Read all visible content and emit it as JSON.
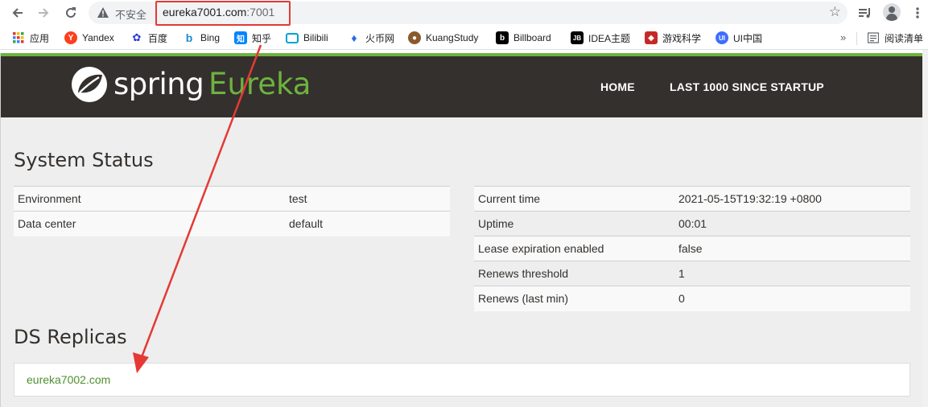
{
  "browser": {
    "insecure_label": "不安全",
    "url_host": "eureka7001.com",
    "url_port": ":7001",
    "bookmarks": [
      {
        "label": "应用",
        "icon": "apps-grid-icon",
        "color": "#e53935"
      },
      {
        "label": "Yandex",
        "icon": "yandex-icon",
        "color": "#fc3f1d"
      },
      {
        "label": "百度",
        "icon": "baidu-icon",
        "color": "#2932e1"
      },
      {
        "label": "Bing",
        "icon": "bing-icon",
        "color": "#008373"
      },
      {
        "label": "知乎",
        "icon": "zhihu-icon",
        "color": "#0084ff"
      },
      {
        "label": "Bilibili",
        "icon": "bilibili-icon",
        "color": "#00a1d6"
      },
      {
        "label": "火币网",
        "icon": "huobi-icon",
        "color": "#2a6ae8"
      },
      {
        "label": "KuangStudy",
        "icon": "kuangstudy-icon",
        "color": "#8a5a2b"
      },
      {
        "label": "Billboard",
        "icon": "billboard-icon",
        "color": "#000000"
      },
      {
        "label": "IDEA主题",
        "icon": "jetbrains-icon",
        "color": "#000000"
      },
      {
        "label": "游戏科学",
        "icon": "game-science-icon",
        "color": "#c62828"
      },
      {
        "label": "UI中国",
        "icon": "ui-china-icon",
        "color": "#3d6dff"
      }
    ],
    "bookmarks_more": "»",
    "reading_list": "阅读清单"
  },
  "header": {
    "brand_spring": "spring",
    "brand_eureka": "Eureka",
    "nav": [
      "HOME",
      "LAST 1000 SINCE STARTUP"
    ]
  },
  "system_status": {
    "title": "System Status",
    "left_rows": [
      {
        "key": "Environment",
        "value": "test"
      },
      {
        "key": "Data center",
        "value": "default"
      }
    ],
    "right_rows": [
      {
        "key": "Current time",
        "value": "2021-05-15T19:32:19 +0800"
      },
      {
        "key": "Uptime",
        "value": "00:01"
      },
      {
        "key": "Lease expiration enabled",
        "value": "false"
      },
      {
        "key": "Renews threshold",
        "value": "1"
      },
      {
        "key": "Renews (last min)",
        "value": "0"
      }
    ]
  },
  "ds_replicas": {
    "title": "DS Replicas",
    "replicas": [
      "eureka7002.com"
    ]
  },
  "colors": {
    "spring_green": "#6db33f",
    "header_bg": "#34302d",
    "annotation_red": "#e53935",
    "link_green": "#4f8f2f"
  }
}
